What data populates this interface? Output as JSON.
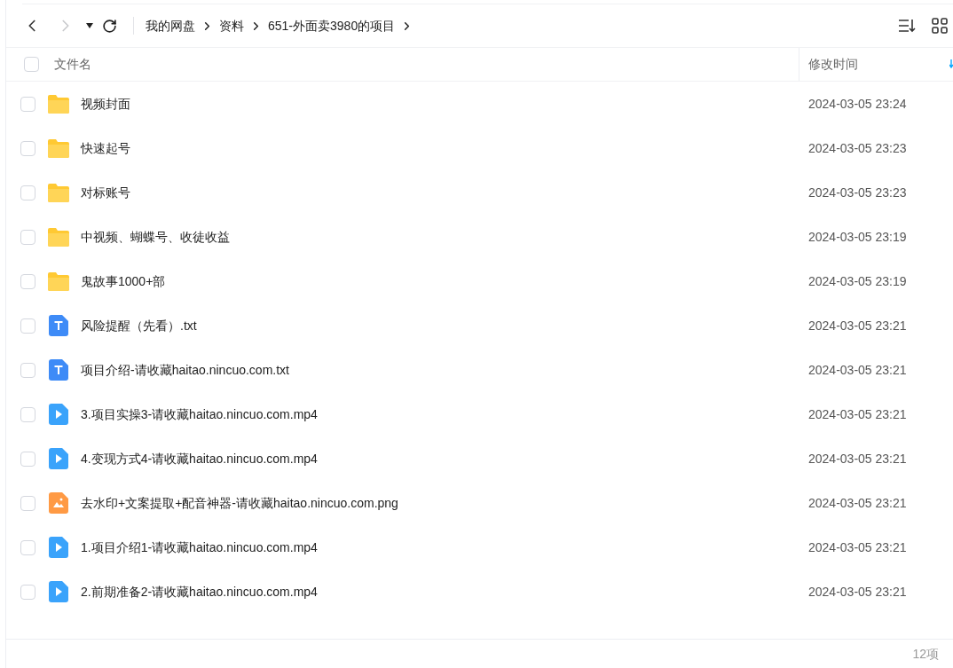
{
  "breadcrumb": [
    {
      "label": "我的网盘"
    },
    {
      "label": "资料"
    },
    {
      "label": "651-外面卖3980的项目"
    }
  ],
  "table": {
    "select_all": {
      "checked": false
    },
    "columns": [
      {
        "label": "文件名"
      },
      {
        "label": "修改时间"
      }
    ],
    "rows": [
      {
        "kind": "folder",
        "name": "视频封面",
        "modified": "2024-03-05 23:24",
        "checked": false
      },
      {
        "kind": "folder",
        "name": "快速起号",
        "modified": "2024-03-05 23:23",
        "checked": false
      },
      {
        "kind": "folder",
        "name": "对标账号",
        "modified": "2024-03-05 23:23",
        "checked": false
      },
      {
        "kind": "folder",
        "name": "中视频、蝴蝶号、收徒收益",
        "modified": "2024-03-05 23:19",
        "checked": false
      },
      {
        "kind": "folder",
        "name": "鬼故事1000+部",
        "modified": "2024-03-05 23:19",
        "checked": false
      },
      {
        "kind": "text",
        "name": "风险提醒（先看）.txt",
        "modified": "2024-03-05 23:21",
        "checked": false
      },
      {
        "kind": "text",
        "name": "项目介绍-请收藏haitao.nincuo.com.txt",
        "modified": "2024-03-05 23:21",
        "checked": false
      },
      {
        "kind": "video",
        "name": "3.项目实操3-请收藏haitao.nincuo.com.mp4",
        "modified": "2024-03-05 23:21",
        "checked": false
      },
      {
        "kind": "video",
        "name": "4.变现方式4-请收藏haitao.nincuo.com.mp4",
        "modified": "2024-03-05 23:21",
        "checked": false
      },
      {
        "kind": "image",
        "name": "去水印+文案提取+配音神器-请收藏haitao.nincuo.com.png",
        "modified": "2024-03-05 23:21",
        "checked": false
      },
      {
        "kind": "video",
        "name": "1.项目介绍1-请收藏haitao.nincuo.com.mp4",
        "modified": "2024-03-05 23:21",
        "checked": false
      },
      {
        "kind": "video",
        "name": "2.前期准备2-请收藏haitao.nincuo.com.mp4",
        "modified": "2024-03-05 23:21",
        "checked": false
      }
    ]
  },
  "status_bar": {
    "count": "12项"
  }
}
